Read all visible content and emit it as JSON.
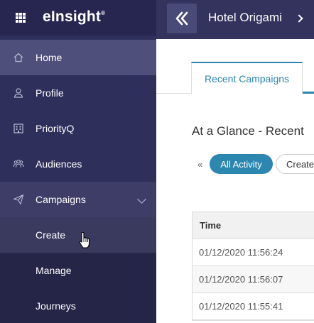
{
  "brand": {
    "name": "eInsight",
    "mark": "®"
  },
  "header": {
    "hotel_name": "Hotel Origami",
    "collapse_glyph": "«"
  },
  "sidebar": {
    "items": [
      {
        "label": "Home",
        "icon": "home-icon"
      },
      {
        "label": "Profile",
        "icon": "user-icon"
      },
      {
        "label": "PriorityQ",
        "icon": "building-icon"
      },
      {
        "label": "Audiences",
        "icon": "people-icon"
      },
      {
        "label": "Campaigns",
        "icon": "paper-plane-icon"
      }
    ],
    "sub_items": [
      {
        "label": "Create"
      },
      {
        "label": "Manage"
      },
      {
        "label": "Journeys"
      }
    ]
  },
  "main": {
    "tab_label": "Recent Campaigns",
    "section_title": "At a Glance - Recent",
    "filter_prev": "«",
    "filters": [
      "All Activity",
      "Create"
    ],
    "table": {
      "header": "Time",
      "rows": [
        "01/12/2020 11:56:24",
        "01/12/2020 11:56:07",
        "01/12/2020 11:55:41"
      ]
    }
  },
  "colors": {
    "sidebar": "#2f2f5c",
    "accent": "#2b86b0"
  }
}
